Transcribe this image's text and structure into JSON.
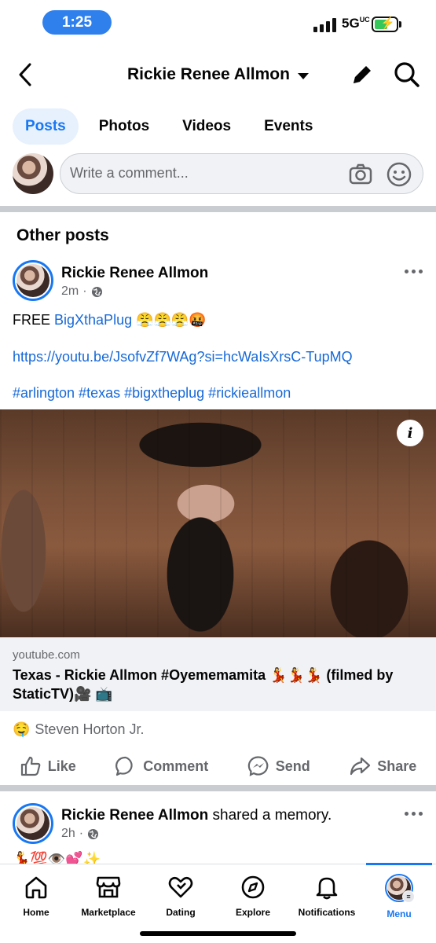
{
  "status_bar": {
    "time": "1:25",
    "network": "5G",
    "network_suffix": "UC"
  },
  "header": {
    "title": "Rickie Renee Allmon"
  },
  "tabs": [
    {
      "label": "Posts",
      "active": true
    },
    {
      "label": "Photos",
      "active": false
    },
    {
      "label": "Videos",
      "active": false
    },
    {
      "label": "Events",
      "active": false
    }
  ],
  "composer": {
    "placeholder": "Write a comment..."
  },
  "section_title": "Other posts",
  "post": {
    "author": "Rickie Renee Allmon",
    "time": "2m",
    "line1_prefix": "FREE ",
    "line1_link": "BigXthaPlug",
    "line1_emoji": "😤😤😤🤬",
    "url": "https://youtu.be/JsofvZf7WAg?si=hcWaIsXrsC-TupMQ",
    "hashtags": "#arlington #texas #bigxtheplug #rickieallmon",
    "link_domain": "youtube.com",
    "link_title": "Texas - Rickie Allmon #Oyememamita 💃💃💃 (filmed by StaticTV)🎥 📺",
    "reaction_emoji": "🤤",
    "reaction_name": "Steven Horton Jr."
  },
  "actions": {
    "like": "Like",
    "comment": "Comment",
    "send": "Send",
    "share": "Share"
  },
  "post2": {
    "author": "Rickie Renee Allmon",
    "action": " shared a memory.",
    "time": "2h",
    "preview": "💃💯👁️💕✨"
  },
  "nav": [
    {
      "label": "Home",
      "icon": "home-icon"
    },
    {
      "label": "Marketplace",
      "icon": "marketplace-icon"
    },
    {
      "label": "Dating",
      "icon": "dating-icon"
    },
    {
      "label": "Explore",
      "icon": "explore-icon"
    },
    {
      "label": "Notifications",
      "icon": "bell-icon"
    },
    {
      "label": "Menu",
      "icon": "menu-avatar",
      "active": true
    }
  ],
  "colors": {
    "accent": "#1877f2",
    "link": "#1769d8",
    "secondary_text": "#65676b",
    "divider": "#c9ccd1",
    "status_pill": "#2f80ed"
  }
}
